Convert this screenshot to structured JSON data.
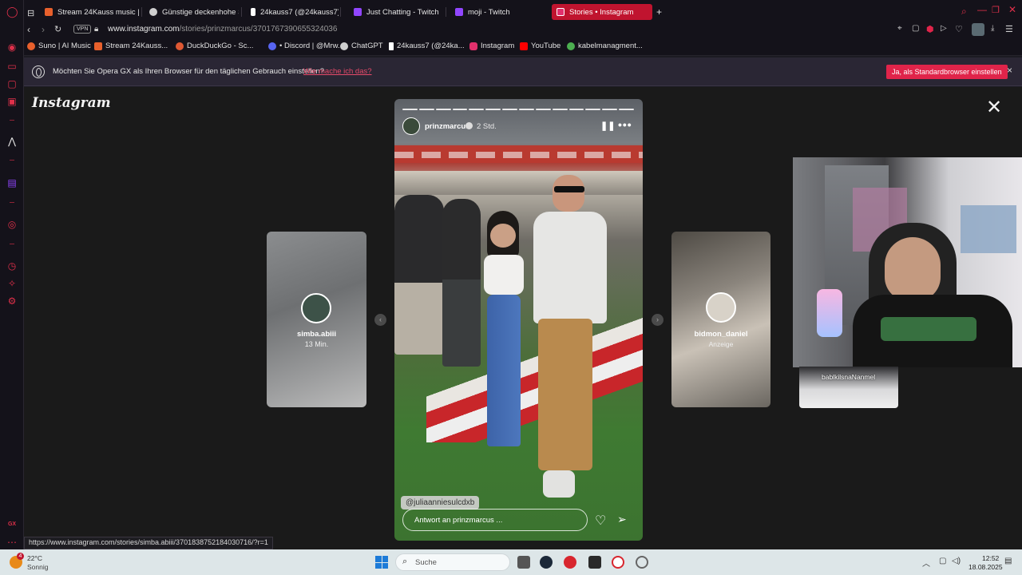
{
  "browser": {
    "tabs": [
      {
        "label": "Stream 24Kauss music |",
        "favicon_color": "#e8602c"
      },
      {
        "label": "Günstige deckenhohe Sc",
        "favicon_color": "#cfcfcf"
      },
      {
        "label": "24kauss7 (@24kauss7) |",
        "favicon_color": "#ffffff"
      },
      {
        "label": "Just Chatting - Twitch",
        "favicon_color": "#9146ff"
      },
      {
        "label": "moji - Twitch",
        "favicon_color": "#9146ff"
      },
      {
        "label": "Stories • Instagram",
        "favicon_color": "#e1306c"
      }
    ],
    "new_tab": "+",
    "vpn": "VPN",
    "url_host": "www.instagram.com",
    "url_path": "/stories/prinzmarcus/3701767390655324036",
    "bookmarks": [
      {
        "label": "Suno | AI Music",
        "color": "#e8602c"
      },
      {
        "label": "Stream 24Kauss...",
        "color": "#e8602c"
      },
      {
        "label": "DuckDuckGo - Sc...",
        "color": "#de5833"
      },
      {
        "label": "• Discord | @Mrw...",
        "color": "#5865f2"
      },
      {
        "label": "ChatGPT",
        "color": "#cfcfcf"
      },
      {
        "label": "24kauss7 (@24ka...",
        "color": "#ffffff"
      },
      {
        "label": "Instagram",
        "color": "#e1306c"
      },
      {
        "label": "YouTube",
        "color": "#ff0000"
      },
      {
        "label": "kabelmanagment...",
        "color": "#4caf50"
      }
    ]
  },
  "notification": {
    "text": "Möchten Sie Opera GX als Ihren Browser für den täglichen Gebrauch einstellen?",
    "link": "Wie mache ich das?",
    "button": "Ja, als Standardbrowser einstellen",
    "close": "×"
  },
  "instagram": {
    "logo": "Instagram",
    "close": "✕",
    "prev_story": {
      "user": "simba.abiii",
      "time": "13 Min."
    },
    "next_story": {
      "user": "bidmon_daniel",
      "label": "Anzeige"
    },
    "story": {
      "user": "prinzmarcus",
      "time": "2 Std.",
      "mention": "@juliaanniesulcdxb",
      "reply_placeholder": "Antwort an prinzmarcus ...",
      "segments": 14
    }
  },
  "webcam": {
    "overlay_text": "bablkilsnaNanmel"
  },
  "status_url": "https://www.instagram.com/stories/simba.abiii/3701838752184030716/?r=1",
  "taskbar": {
    "weather_temp": "22°C",
    "weather_desc": "Sonnig",
    "weather_badge": "4",
    "search_placeholder": "Suche",
    "time": "12:52",
    "date": "18.08.2025"
  }
}
